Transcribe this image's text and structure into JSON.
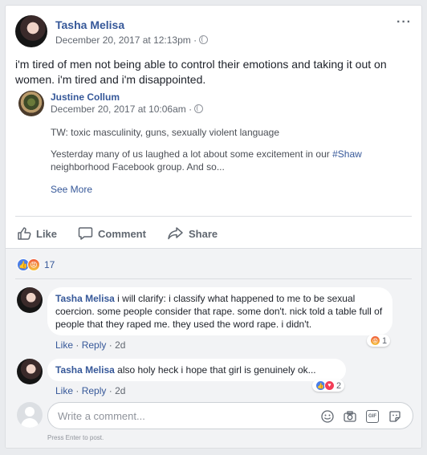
{
  "post": {
    "author": "Tasha Melisa",
    "timestamp": "December 20, 2017 at 12:13pm",
    "separator": "·",
    "text": "i'm tired of men not being able to control their emotions and taking it out on women. i'm tired and i'm disappointed.",
    "more_label": "···"
  },
  "shared": {
    "author": "Justine Collum",
    "timestamp": "December 20, 2017 at 10:06am",
    "separator": "·",
    "tw_line": "TW: toxic masculinity, guns, sexually violent language",
    "body_before": "Yesterday many of us laughed a lot about some excitement in our ",
    "hashtag": "#Shaw",
    "body_after": " neighborhood Facebook group. And so...",
    "see_more": "See More"
  },
  "actions": {
    "like": "Like",
    "comment": "Comment",
    "share": "Share"
  },
  "reactions": {
    "count": "17",
    "types": [
      "like-icon",
      "angry-icon"
    ]
  },
  "comments": [
    {
      "author": "Tasha Melisa",
      "text": " i will clarify: i classify what happened to me to be sexual coercion. some people consider that rape. some don't. nick told a table full of people that they raped me. they used the word rape. i didn't.",
      "like": "Like",
      "reply": "Reply",
      "dot": "·",
      "age": "2d",
      "reaction_count": "1",
      "reaction_types": [
        "angry-icon"
      ]
    },
    {
      "author": "Tasha Melisa",
      "text": " also holy heck i hope that girl is genuinely ok...",
      "like": "Like",
      "reply": "Reply",
      "dot": "·",
      "age": "2d",
      "reaction_count": "2",
      "reaction_types": [
        "like-icon",
        "love-icon"
      ]
    }
  ],
  "composer": {
    "placeholder": "Write a comment...",
    "hint": "Press Enter to post.",
    "gif_label": "GIF"
  },
  "colors": {
    "link": "#365899",
    "like": "#4a7ee8",
    "love": "#f33e58"
  }
}
